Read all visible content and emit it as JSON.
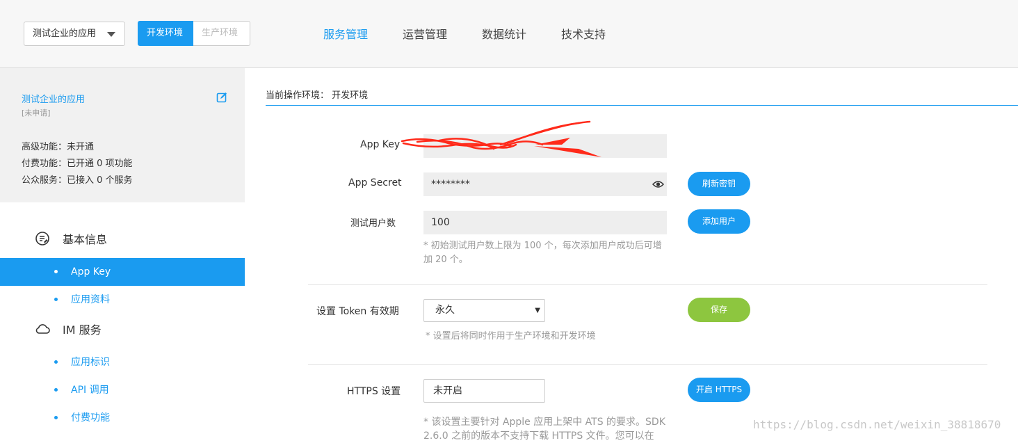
{
  "header": {
    "app_select": "测试企业的应用",
    "env_dev": "开发环境",
    "env_prod": "生产环境",
    "nav": [
      "服务管理",
      "运营管理",
      "数据统计",
      "技术支持"
    ]
  },
  "sidebar": {
    "app_name": "测试企业的应用",
    "app_status": "[未申请]",
    "summary": [
      "高级功能：未开通",
      "付费功能：已开通 0 项功能",
      "公众服务：已接入 0 个服务"
    ],
    "sections": [
      {
        "title": "基本信息",
        "items": [
          "App Key",
          "应用资料"
        ]
      },
      {
        "title": "IM 服务",
        "items": [
          "应用标识",
          "API 调用",
          "付费功能"
        ]
      }
    ]
  },
  "content": {
    "env_label": "当前操作环境：  开发环境",
    "app_key_label": "App Key",
    "app_secret_label": "App Secret",
    "app_secret_value": "********",
    "refresh_button": "刷新密钥",
    "test_users_label": "测试用户数",
    "test_users_value": "100",
    "add_user_button": "添加用户",
    "test_users_hint": "* 初始测试用户数上限为 100 个，每次添加用户成功后可增加 20 个。",
    "token_label": "设置 Token 有效期",
    "token_value": "永久",
    "save_button": "保存",
    "token_hint": "* 设置后将同时作用于生产环境和开发环境",
    "https_label": "HTTPS 设置",
    "https_value": "未开启",
    "https_button": "开启 HTTPS",
    "https_hint": "* 该设置主要针对 Apple 应用上架中 ATS 的要求。SDK 2.6.0 之前的版本不支持下载 HTTPS 文件。您可以在"
  },
  "watermark": "https://blog.csdn.net/weixin_38818670",
  "colors": {
    "accent": "#1a9bf0",
    "save": "#8dc63f",
    "annotation": "#ff2a1a"
  }
}
